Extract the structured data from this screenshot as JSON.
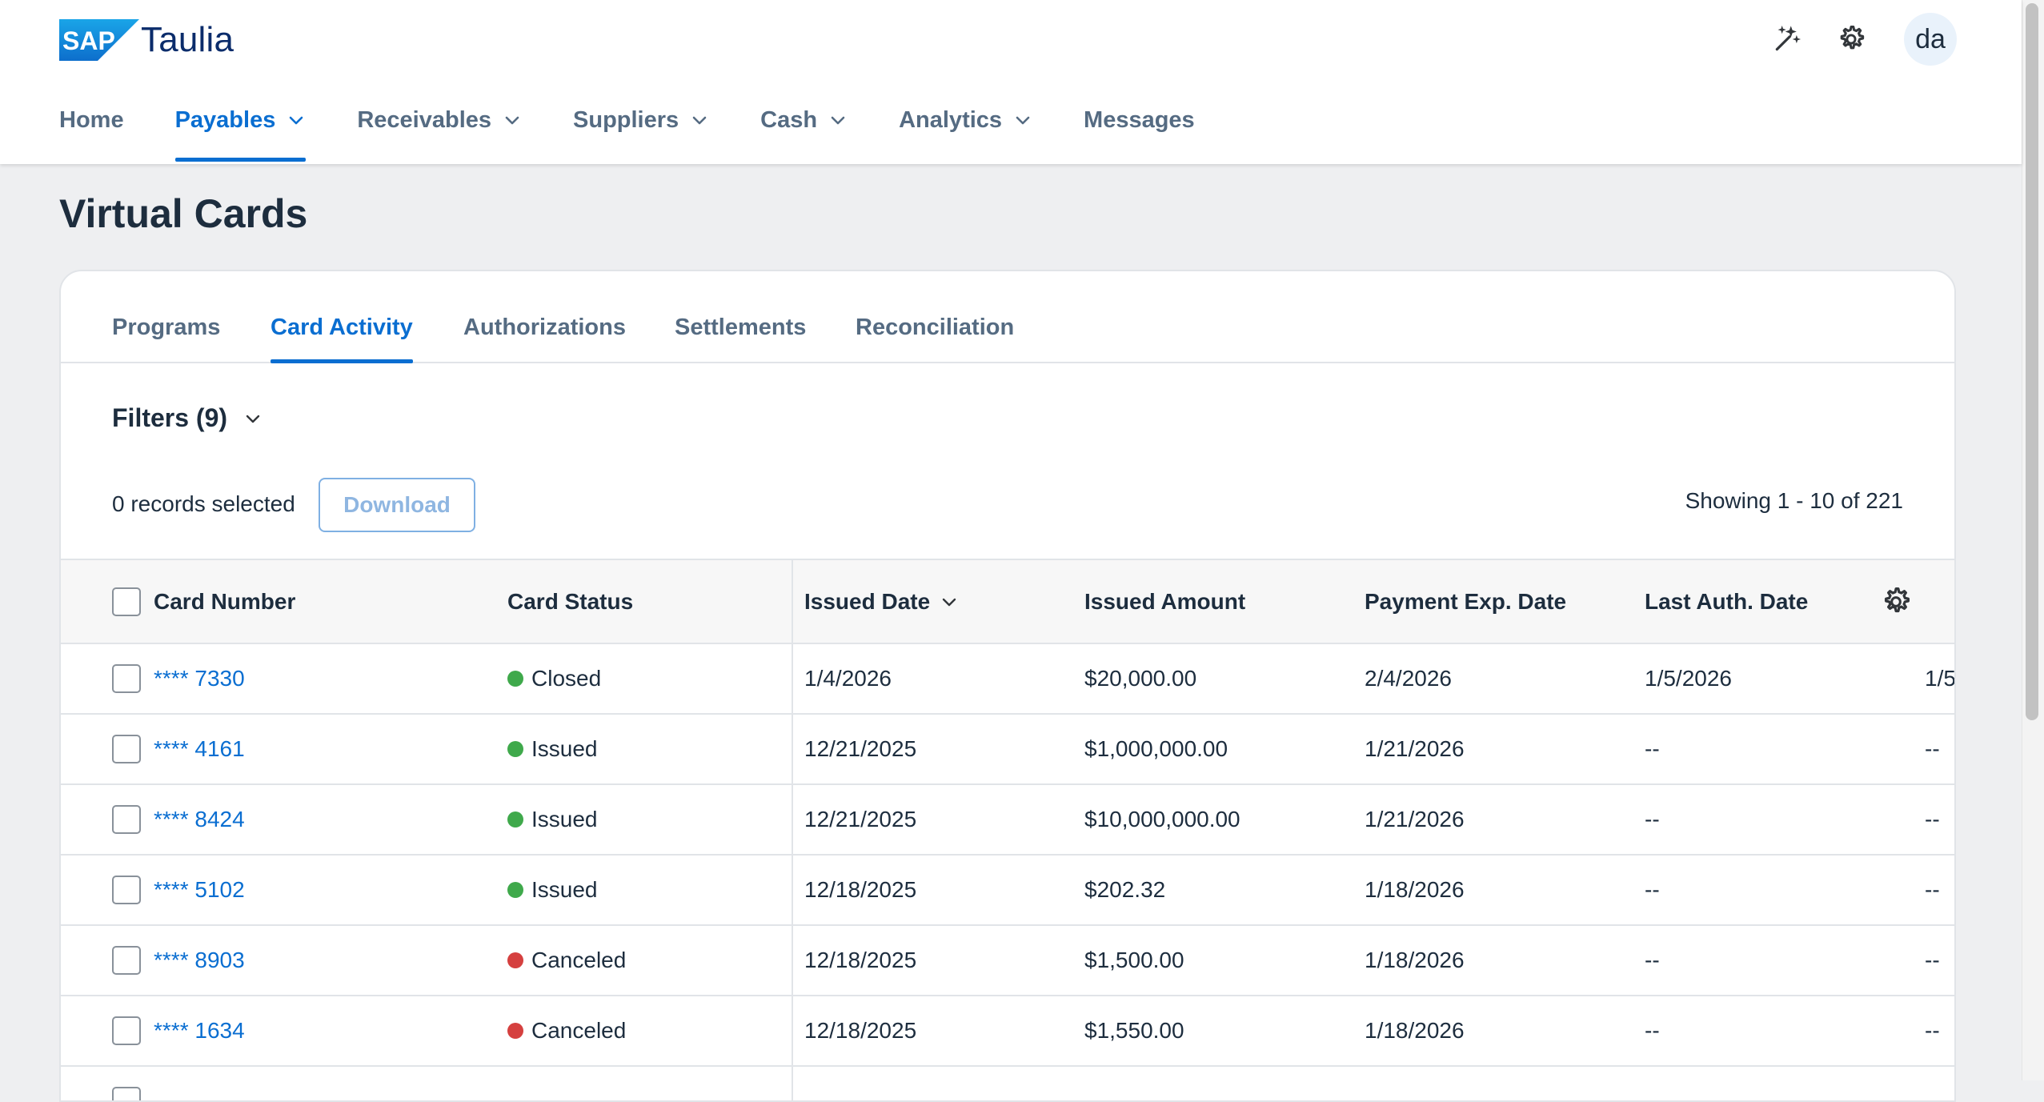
{
  "header": {
    "logo_text": "SAP",
    "brand": "Taulia",
    "avatar_initials": "da",
    "icons": [
      "magic-wand-icon",
      "gear-icon"
    ]
  },
  "nav": {
    "items": [
      {
        "label": "Home",
        "has_dropdown": false
      },
      {
        "label": "Payables",
        "has_dropdown": true,
        "active": true
      },
      {
        "label": "Receivables",
        "has_dropdown": true
      },
      {
        "label": "Suppliers",
        "has_dropdown": true
      },
      {
        "label": "Cash",
        "has_dropdown": true
      },
      {
        "label": "Analytics",
        "has_dropdown": true
      },
      {
        "label": "Messages",
        "has_dropdown": false
      }
    ]
  },
  "page": {
    "title": "Virtual Cards"
  },
  "tabs": {
    "items": [
      "Programs",
      "Card Activity",
      "Authorizations",
      "Settlements",
      "Reconciliation"
    ],
    "active": "Card Activity"
  },
  "filters": {
    "label": "Filters (9)"
  },
  "toolbar": {
    "records_selected": "0 records selected",
    "download_label": "Download",
    "showing": "Showing 1 - 10 of 221"
  },
  "table": {
    "columns": {
      "card_number": "Card Number",
      "card_status": "Card Status",
      "issued_date": "Issued Date",
      "issued_amount": "Issued Amount",
      "payment_exp_date": "Payment Exp. Date",
      "last_auth_date": "Last Auth. Date"
    },
    "rows": [
      {
        "card_number": "**** 7330",
        "status": "Closed",
        "status_color": "#3fa94b",
        "issued_date": "1/4/2026",
        "issued_amount": "$20,000.00",
        "payment_exp_date": "2/4/2026",
        "last_auth_date": "1/5/2026",
        "overflow": "1/5"
      },
      {
        "card_number": "**** 4161",
        "status": "Issued",
        "status_color": "#3fa94b",
        "issued_date": "12/21/2025",
        "issued_amount": "$1,000,000.00",
        "payment_exp_date": "1/21/2026",
        "last_auth_date": "--",
        "overflow": "--"
      },
      {
        "card_number": "**** 8424",
        "status": "Issued",
        "status_color": "#3fa94b",
        "issued_date": "12/21/2025",
        "issued_amount": "$10,000,000.00",
        "payment_exp_date": "1/21/2026",
        "last_auth_date": "--",
        "overflow": "--"
      },
      {
        "card_number": "**** 5102",
        "status": "Issued",
        "status_color": "#3fa94b",
        "issued_date": "12/18/2025",
        "issued_amount": "$202.32",
        "payment_exp_date": "1/18/2026",
        "last_auth_date": "--",
        "overflow": "--"
      },
      {
        "card_number": "**** 8903",
        "status": "Canceled",
        "status_color": "#d5403f",
        "issued_date": "12/18/2025",
        "issued_amount": "$1,500.00",
        "payment_exp_date": "1/18/2026",
        "last_auth_date": "--",
        "overflow": "--"
      },
      {
        "card_number": "**** 1634",
        "status": "Canceled",
        "status_color": "#d5403f",
        "issued_date": "12/18/2025",
        "issued_amount": "$1,550.00",
        "payment_exp_date": "1/18/2026",
        "last_auth_date": "--",
        "overflow": "--"
      },
      {
        "card_number": "",
        "status": "",
        "status_color": "#ffffff",
        "issued_date": "",
        "issued_amount": "",
        "payment_exp_date": "",
        "last_auth_date": "",
        "overflow": ""
      }
    ]
  },
  "colors": {
    "accent": "#0a6ed1",
    "status_open": "#3fa94b",
    "status_canceled": "#d5403f"
  }
}
